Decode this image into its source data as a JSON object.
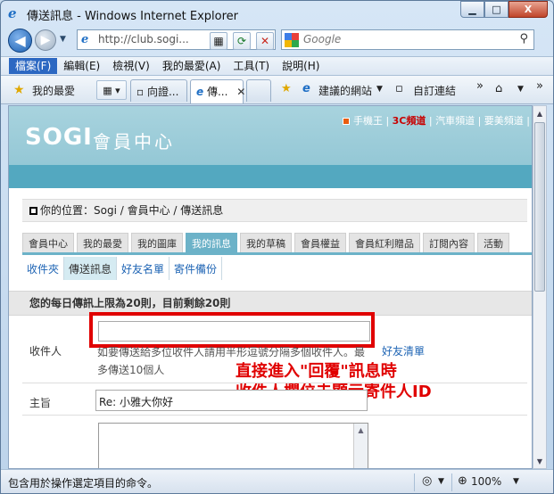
{
  "window": {
    "title": "傳送訊息 - Windows Internet Explorer",
    "min_glyph": "▁",
    "max_glyph": "□",
    "close_glyph": "X"
  },
  "nav": {
    "address": "http://club.sogi...",
    "search_placeholder": "Google"
  },
  "menu": {
    "items": [
      "檔案(F)",
      "編輯(E)",
      "檢視(V)",
      "我的最愛(A)",
      "工具(T)",
      "說明(H)"
    ]
  },
  "favbar": {
    "favorites_label": "我的最愛",
    "tab1_label": "向證...",
    "tab2_label": "傳...",
    "suggested_sites": "建議的網站",
    "custom_links": "自訂連結"
  },
  "site": {
    "logo": "SOGI",
    "logo_sub": "會員中心",
    "header_link_1": "手機王",
    "header_link_2": "3C頻道",
    "header_link_3": "汽車頻道",
    "header_link_4": "要美頻道",
    "breadcrumb": "你的位置：Sogi / 會員中心 / 傳送訊息"
  },
  "tabs": [
    "會員中心",
    "我的最愛",
    "我的圖庫",
    "我的訊息",
    "我的草稿",
    "會員權益",
    "會員紅利贈品",
    "訂閱內容",
    "活動"
  ],
  "subtabs": [
    "收件夾",
    "傳送訊息",
    "好友名單",
    "寄件備份"
  ],
  "form": {
    "notice": "您的每日傳訊上限為20則，目前剩餘20則",
    "recipient_label": "收件人",
    "recipient_hint": "如要傳送給多位收件人請用半形逗號分隔多個收件人。最多傳送10個人",
    "friend_list_link": "好友清單",
    "subject_label": "主旨",
    "subject_value": "Re: 小雅大你好"
  },
  "annotation": {
    "line1": "直接進入\"回覆\"訊息時",
    "line2": "收件人欄位未顯示寄件人ID"
  },
  "status": {
    "text": "包含用於操作選定項目的命令。",
    "zoom": "100%"
  }
}
